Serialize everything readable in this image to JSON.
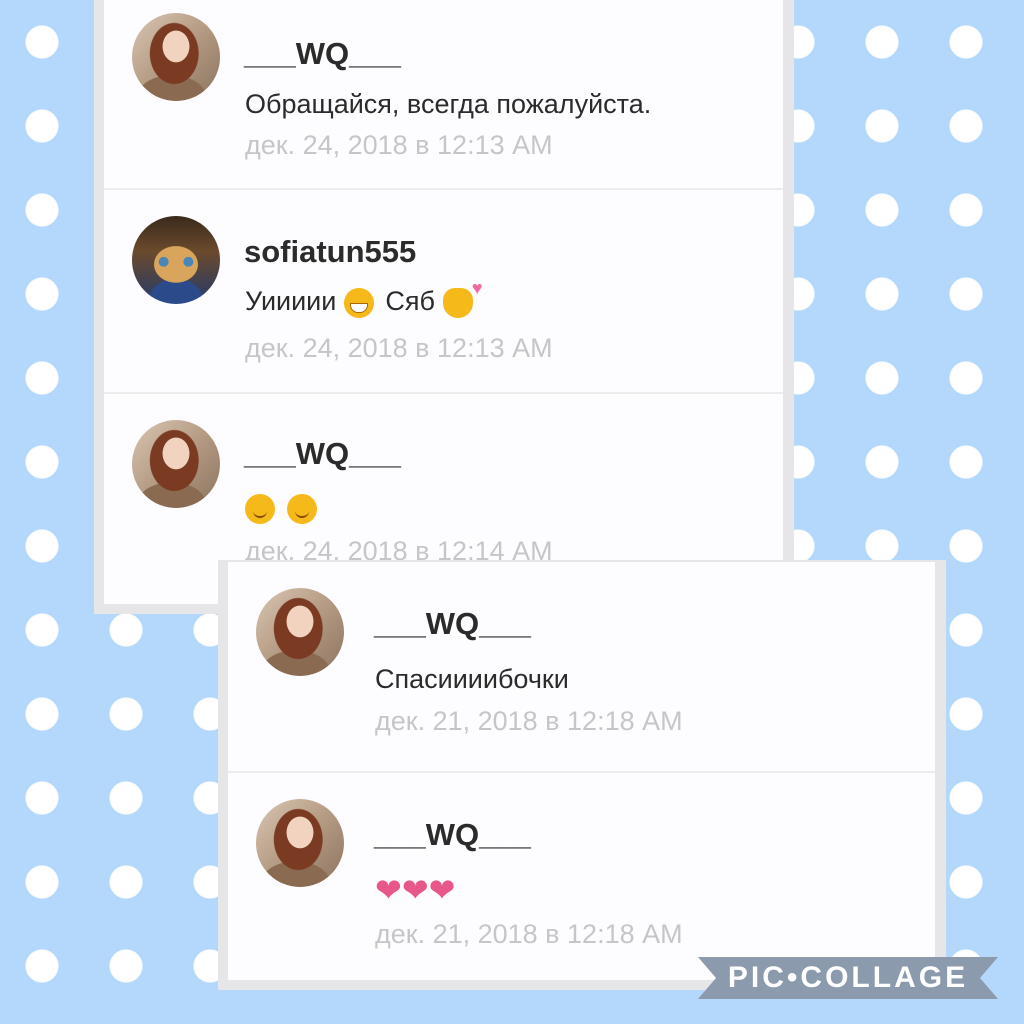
{
  "panels": [
    {
      "comments": [
        {
          "username": "___WQ___",
          "message": "Обращайся, всегда пожалуйста.",
          "timestamp": "дек. 24, 2018 в 12:13 AM",
          "avatar": "girl-avatar"
        },
        {
          "username": "sofiatun555",
          "message_parts": [
            "Уиииии",
            "Сяб"
          ],
          "emojis": [
            "grinning-face-emoji",
            "kissing-face-emoji"
          ],
          "timestamp": "дек. 24, 2018 в 12:13 AM",
          "avatar": "cat-avatar"
        },
        {
          "username": "___WQ___",
          "emojis": [
            "winking-face-emoji",
            "smiling-face-emoji"
          ],
          "timestamp": "дек. 24, 2018 в 12:14 AM",
          "avatar": "girl-avatar"
        }
      ]
    },
    {
      "comments": [
        {
          "username": "___WQ___",
          "message": "Спасиииибочки",
          "timestamp": "дек. 21, 2018 в 12:18 AM",
          "avatar": "girl-avatar"
        },
        {
          "username": "___WQ___",
          "message_hearts": "❤❤❤",
          "timestamp": "дек. 21, 2018 в 12:18 AM",
          "avatar": "girl-avatar"
        }
      ]
    }
  ],
  "watermark": "PIC•COLLAGE",
  "colors": {
    "background": "#b3d8fb",
    "panel": "#fdfcfe",
    "timestamp": "#c6c6c8",
    "heart": "#e8578a"
  }
}
